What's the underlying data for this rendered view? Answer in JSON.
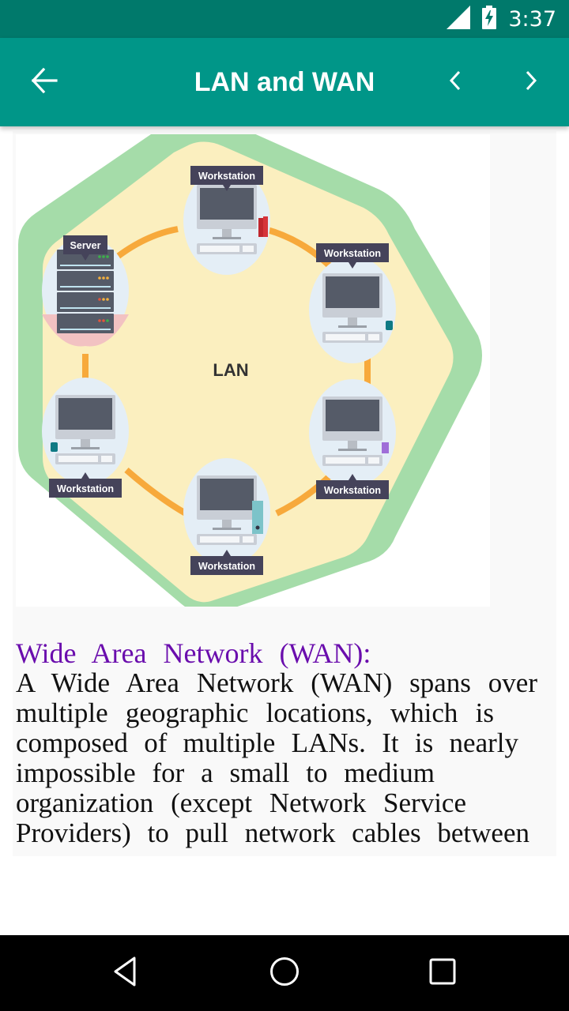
{
  "status_bar": {
    "time": "3:37",
    "icons": [
      "signal-icon",
      "battery-charging-icon"
    ]
  },
  "app_bar": {
    "title": "LAN and WAN",
    "back_icon": "arrow-left-icon",
    "prev_icon": "chevron-left-icon",
    "next_icon": "chevron-right-icon",
    "color": "#009688",
    "status_color": "#00796b"
  },
  "diagram": {
    "center_label": "LAN",
    "nodes": [
      {
        "type": "server",
        "label": "Server",
        "accessory": "none"
      },
      {
        "type": "workstation",
        "label": "Workstation",
        "accessory": "books"
      },
      {
        "type": "workstation",
        "label": "Workstation",
        "accessory": "mug"
      },
      {
        "type": "workstation",
        "label": "Workstation",
        "accessory": "pencil-cup"
      },
      {
        "type": "workstation",
        "label": "Workstation",
        "accessory": "binder"
      },
      {
        "type": "workstation",
        "label": "Workstation",
        "accessory": "mug"
      }
    ],
    "colors": {
      "outer_ring": "#a5dca9",
      "inner_fill": "#fbefbf",
      "connection": "#f7a93b",
      "label_bg": "#45435a",
      "monitor": "#555b68",
      "node_bg": "#e4eef6"
    }
  },
  "article": {
    "heading": "Wide Area Network (WAN):",
    "heading_color": "#6a0dad",
    "lines": [
      "A Wide Area Network (WAN) spans over",
      "multiple geographic locations, which is",
      "composed of multiple LANs. It is nearly",
      "impossible for a small to medium",
      "organization (except Network Service",
      "Providers) to pull network cables between"
    ]
  },
  "nav_bar": {
    "back": "back-triangle-icon",
    "home": "home-circle-icon",
    "recents": "recents-square-icon"
  }
}
